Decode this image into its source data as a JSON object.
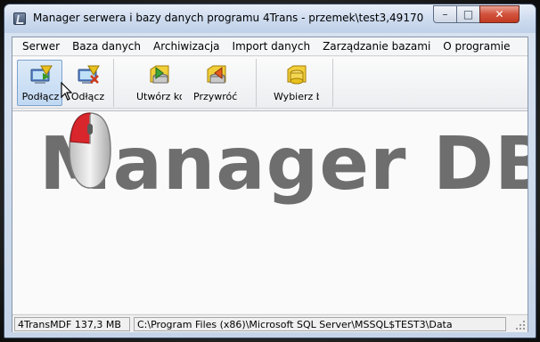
{
  "window": {
    "title": "Manager serwera i bazy danych programu 4Trans - przemek\\test3,49170",
    "minimize_glyph": "–",
    "maximize_glyph": "□",
    "close_glyph": "✕"
  },
  "menu": [
    "Serwer",
    "Baza danych",
    "Archiwizacja",
    "Import danych",
    "Zarządzanie bazami",
    "O programie"
  ],
  "toolbar": {
    "connect": {
      "label": "Podłącz",
      "icon": "connect-icon"
    },
    "disconnect": {
      "label": "Odłącz",
      "icon": "disconnect-icon"
    },
    "backup": {
      "label": "Utwórz ko...",
      "icon": "backup-create-icon"
    },
    "restore": {
      "label": "Przywróć ...",
      "icon": "backup-restore-icon"
    },
    "select": {
      "label": "Wybierz b...",
      "icon": "select-database-icon"
    }
  },
  "splash": {
    "title": "Manager DB"
  },
  "status": {
    "database": "4TransMDF  137,3 MB",
    "path": "C:\\Program Files (x86)\\Microsoft SQL Server\\MSSQL$TEST3\\Data"
  },
  "colors": {
    "title_gray": "#6e6e6e",
    "close_red": "#c23a22",
    "highlight_blue": "#c0d8f2"
  }
}
